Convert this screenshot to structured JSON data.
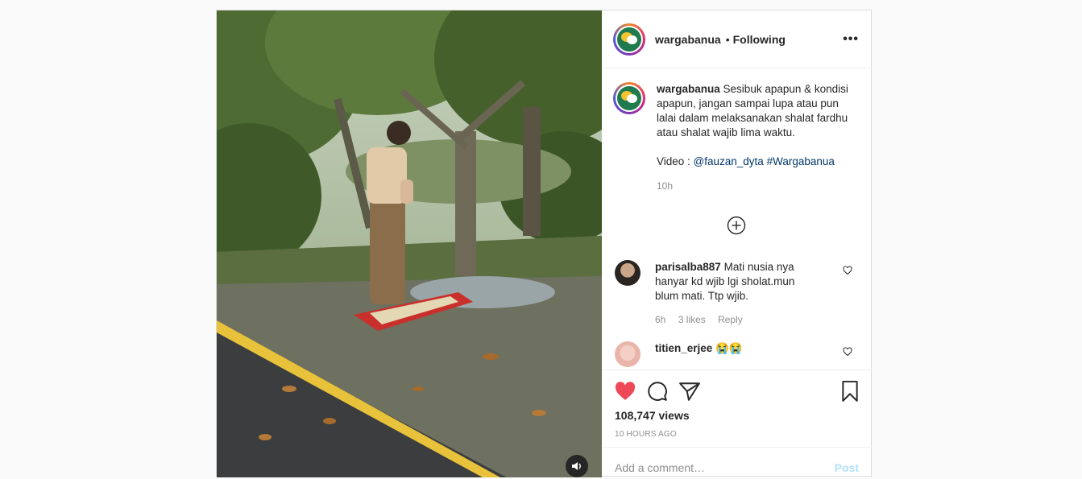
{
  "header": {
    "username": "wargabanua",
    "separator": "•",
    "follow_status": "Following",
    "more_icon": "more-horizontal-icon"
  },
  "caption": {
    "username": "wargabanua",
    "text": "Sesibuk apapun & kondisi apapun, jangan sampai lupa atau pun lalai dalam melaksanakan shalat fardhu atau shalat wajib lima waktu.",
    "credit_prefix": "Video : ",
    "mention": "@fauzan_dyta",
    "hashtag": "#Wargabanua",
    "time": "10h"
  },
  "comments": [
    {
      "username": "parisalba887",
      "text": "Mati nusia nya hanyar kd wjib lgi sholat.mun blum mati. Ttp wjib.",
      "time": "6h",
      "likes": "3 likes",
      "reply": "Reply"
    },
    {
      "username": "titien_erjee",
      "text": "😭😭"
    }
  ],
  "stats": {
    "views": "108,747 views",
    "time_ago": "10 HOURS AGO"
  },
  "add_comment": {
    "placeholder": "Add a comment…",
    "post_label": "Post"
  },
  "colors": {
    "like_red": "#ed4956",
    "link_blue": "#00376b",
    "muted": "#8e8e8e",
    "post_disabled": "#b2dffc"
  }
}
